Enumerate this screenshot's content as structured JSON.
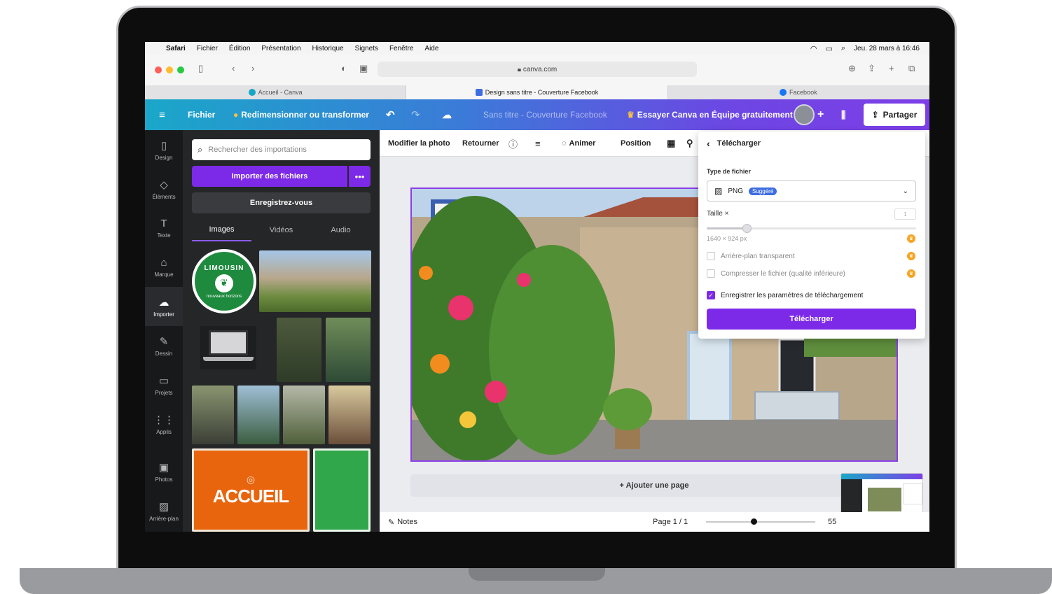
{
  "menubar": {
    "apple": "",
    "app": "Safari",
    "items": [
      "Fichier",
      "Édition",
      "Présentation",
      "Historique",
      "Signets",
      "Fenêtre",
      "Aide"
    ],
    "datetime": "Jeu. 28 mars à 16:46"
  },
  "browser": {
    "url": "canva.com",
    "tabs": [
      {
        "label": "Accueil - Canva",
        "color": "#16a6c7"
      },
      {
        "label": "Design sans titre - Couverture Facebook",
        "color": "#3d6de3"
      },
      {
        "label": "Facebook",
        "color": "#1877f2"
      }
    ]
  },
  "header": {
    "menu_icon": "hamburger-icon",
    "file": "Fichier",
    "resize": "Redimensionner ou transformer",
    "doc_title": "Sans titre - Couverture Facebook",
    "team_trial": "Essayer Canva en Équipe gratuitement",
    "share": "Partager"
  },
  "rail": [
    {
      "label": "Design",
      "icon": "▯"
    },
    {
      "label": "Éléments",
      "icon": "◇"
    },
    {
      "label": "Texte",
      "icon": "T"
    },
    {
      "label": "Marque",
      "icon": "⌂"
    },
    {
      "label": "Importer",
      "icon": "☁"
    },
    {
      "label": "Dessin",
      "icon": "✎"
    },
    {
      "label": "Projets",
      "icon": "▭"
    },
    {
      "label": "Applis",
      "icon": "⋮⋮"
    },
    {
      "label": "Photos",
      "icon": "▣"
    },
    {
      "label": "Arrière-plan",
      "icon": "▨"
    }
  ],
  "panel": {
    "search_placeholder": "Rechercher des importations",
    "import": "Importer des fichiers",
    "more": "•••",
    "register": "Enregistrez-vous",
    "tabs": [
      "Images",
      "Vidéos",
      "Audio"
    ],
    "logo_text": "LIMOUSIN",
    "logo_sub": "nouveaux horizons",
    "accueil": "ACCUEIL"
  },
  "toolbar": {
    "edit_photo": "Modifier la photo",
    "flip": "Retourner",
    "animate": "Animer",
    "position": "Position"
  },
  "editor": {
    "add_page": "+ Ajouter une page",
    "notes": "Notes",
    "page": "Page 1 / 1",
    "zoom": "55"
  },
  "download": {
    "title": "Télécharger",
    "file_type_label": "Type de fichier",
    "file_type": "PNG",
    "suggested": "Suggéré",
    "size_label": "Taille ×",
    "size_value": "1",
    "dimensions": "1640 × 924 px",
    "transparent": "Arrière-plan transparent",
    "compress": "Compresser le fichier (qualité inférieure)",
    "save_settings": "Enregistrer les paramètres de téléchargement",
    "button": "Télécharger"
  },
  "colors": {
    "canva_purple": "#7d2ae8",
    "header_start": "#1aa7c9",
    "header_end": "#7d3ee8"
  }
}
